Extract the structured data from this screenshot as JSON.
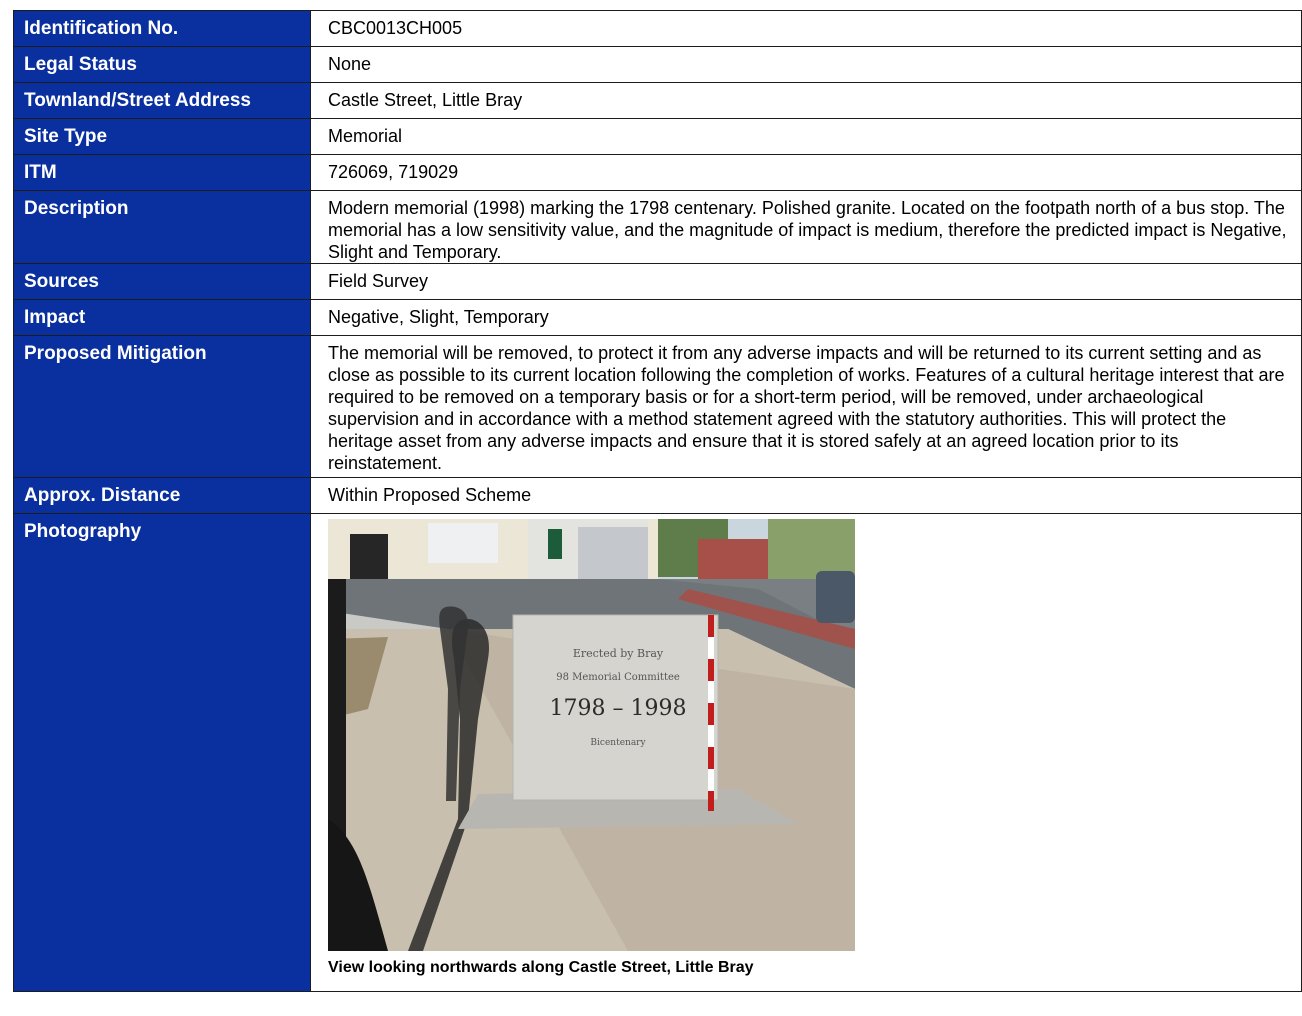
{
  "rows": [
    {
      "label": "Identification No.",
      "value": "CBC0013CH005"
    },
    {
      "label": "Legal Status",
      "value": "None"
    },
    {
      "label": "Townland/Street Address",
      "value": "Castle Street, Little Bray"
    },
    {
      "label": "Site Type",
      "value": "Memorial"
    },
    {
      "label": "ITM",
      "value": "726069, 719029"
    },
    {
      "label": "Description",
      "value": "Modern memorial (1998) marking the 1798 centenary. Polished granite. Located on the footpath north of a bus stop. The memorial has a low sensitivity value, and the magnitude of impact is medium, therefore the predicted impact is Negative, Slight and Temporary."
    },
    {
      "label": "Sources",
      "value": "Field Survey"
    },
    {
      "label": "Impact",
      "value": "Negative, Slight, Temporary"
    },
    {
      "label": "Proposed Mitigation",
      "value": "The memorial will be removed, to protect it from any adverse impacts and will be returned to its current setting and as close as possible to its current location following the completion of works. Features of a cultural heritage interest that are required to be removed on a temporary basis or for a short-term period, will be removed, under archaeological supervision and in accordance with a method statement agreed with the statutory authorities. This will protect the heritage asset from any adverse impacts and ensure that it is stored safely at an agreed location prior to its reinstatement."
    },
    {
      "label": "Approx. Distance",
      "value": "Within Proposed Scheme"
    }
  ],
  "photography": {
    "label": "Photography",
    "caption": "View looking northwards along Castle Street, Little Bray",
    "memorial_text": {
      "line1": "Erected by Bray",
      "line2": "98 Memorial Committee",
      "years": "1798 – 1998",
      "line4": "Bicentenary"
    }
  }
}
